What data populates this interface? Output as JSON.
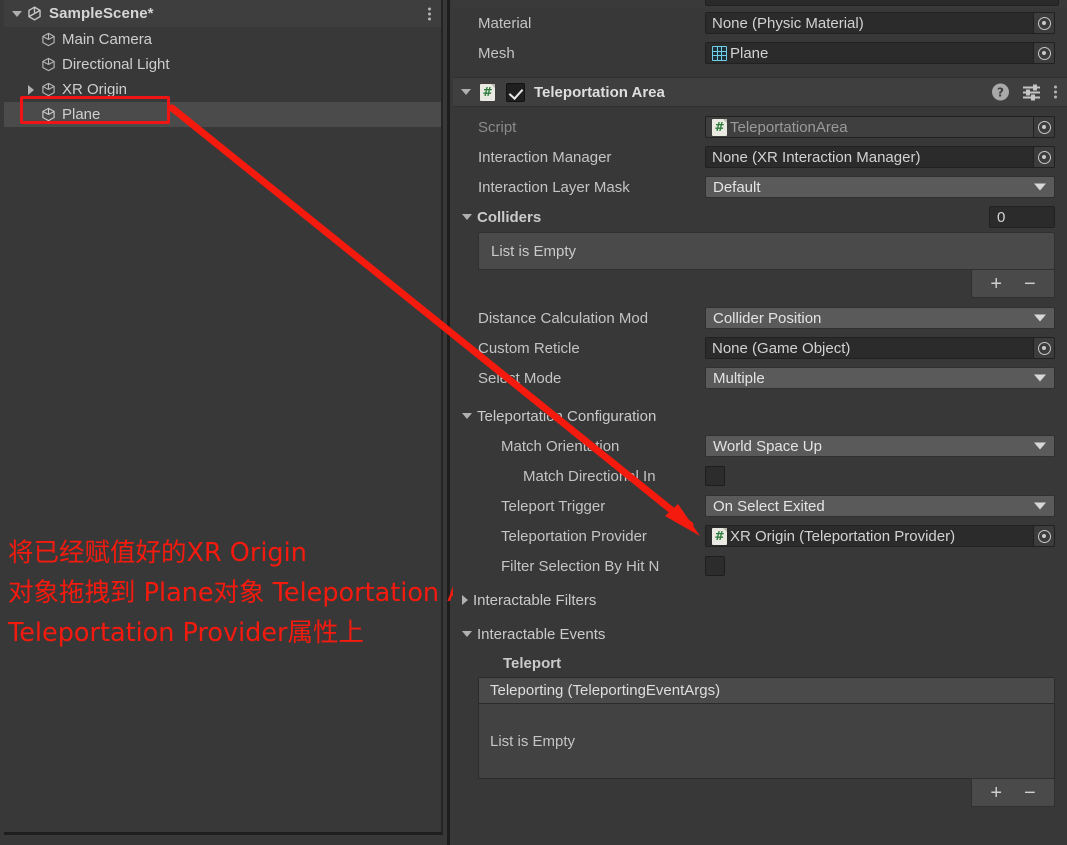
{
  "hierarchy": {
    "scene_name": "SampleScene*",
    "menu_icon": "kebab-menu-icon",
    "items": [
      {
        "label": "Main Camera",
        "icon": "gameobject-cube-icon",
        "expandable": false,
        "selected": false
      },
      {
        "label": "Directional Light",
        "icon": "gameobject-cube-icon",
        "expandable": false,
        "selected": false
      },
      {
        "label": "XR Origin",
        "icon": "gameobject-cube-icon",
        "expandable": true,
        "selected": false
      },
      {
        "label": "Plane",
        "icon": "gameobject-cube-icon",
        "expandable": false,
        "selected": true
      }
    ]
  },
  "annotation": {
    "color": "#f51a0e",
    "line1": "将已经赋值好的XR Origin",
    "line2": "对象拖拽到 Plane对象 Teleportation Area组件下的",
    "line3": "Teleportation Provider属性上",
    "highlight_target": "Plane",
    "arrow": "red-arrow"
  },
  "inspector": {
    "mesh_collider_rows": [
      {
        "label": "Material",
        "value": "None (Physic Material)",
        "type": "object",
        "icon": null
      },
      {
        "label": "Mesh",
        "value": "Plane",
        "type": "object",
        "icon": "mesh-icon"
      }
    ],
    "component": {
      "title": "Teleportation Area",
      "enabled": true,
      "script_icon": "script-hash-icon",
      "help_icon": "help-icon",
      "preset_icon": "preset-sliders-icon",
      "menu_icon": "kebab-menu-icon",
      "rows": [
        {
          "label": "Script",
          "value": "TeleportationArea",
          "type": "object-readonly",
          "icon": "script-hash-icon"
        },
        {
          "label": "Interaction Manager",
          "value": "None (XR Interaction Manager)",
          "type": "object"
        },
        {
          "label": "Interaction Layer Mask",
          "value": "Default",
          "type": "dropdown"
        }
      ],
      "colliders": {
        "section_label": "Colliders",
        "size": "0",
        "empty_text": "List is Empty",
        "add_label": "+",
        "remove_label": "−"
      },
      "rows2": [
        {
          "label": "Distance Calculation Mod",
          "value": "Collider Position",
          "type": "dropdown"
        },
        {
          "label": "Custom Reticle",
          "value": "None (Game Object)",
          "type": "object"
        },
        {
          "label": "Select Mode",
          "value": "Multiple",
          "type": "dropdown"
        }
      ],
      "teleport_config": {
        "section_label": "Teleportation Configuration",
        "rows": [
          {
            "label": "Match Orientation",
            "value": "World Space Up",
            "type": "dropdown",
            "indent": 1
          },
          {
            "label": "Match Directional In",
            "value": false,
            "type": "checkbox",
            "indent": 2
          },
          {
            "label": "Teleport Trigger",
            "value": "On Select Exited",
            "type": "dropdown",
            "indent": 1
          },
          {
            "label": "Teleportation Provider",
            "value": "XR Origin (Teleportation Provider)",
            "type": "object",
            "icon": "script-hash-icon",
            "indent": 1
          },
          {
            "label": "Filter Selection By Hit N",
            "value": false,
            "type": "checkbox",
            "indent": 1
          }
        ]
      },
      "interactable_filters": {
        "section_label": "Interactable Filters",
        "expanded": false
      },
      "interactable_events": {
        "section_label": "Interactable Events",
        "group_label": "Teleport",
        "event_header": "Teleporting (TeleportingEventArgs)",
        "empty_text": "List is Empty",
        "add_label": "+",
        "remove_label": "−"
      }
    }
  }
}
